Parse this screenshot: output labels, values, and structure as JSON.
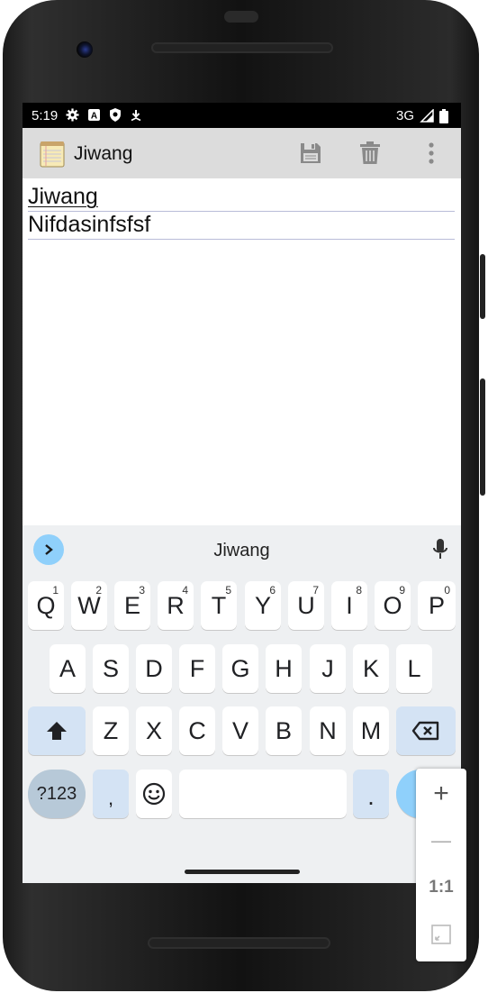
{
  "status_bar": {
    "time": "5:19",
    "network": "3G",
    "icons": [
      "gear-icon",
      "a-badge-icon",
      "shield-icon",
      "download-icon",
      "signal-icon",
      "battery-icon"
    ]
  },
  "app_bar": {
    "title": "Jiwang",
    "actions": [
      "save-icon",
      "delete-icon",
      "overflow-menu-icon"
    ]
  },
  "editor": {
    "lines": [
      "Jiwang",
      "Nifdasinfsfsf"
    ]
  },
  "keyboard": {
    "suggestion": "Jiwang",
    "row1": [
      {
        "label": "Q",
        "hint": "1"
      },
      {
        "label": "W",
        "hint": "2"
      },
      {
        "label": "E",
        "hint": "3"
      },
      {
        "label": "R",
        "hint": "4"
      },
      {
        "label": "T",
        "hint": "5"
      },
      {
        "label": "Y",
        "hint": "6"
      },
      {
        "label": "U",
        "hint": "7"
      },
      {
        "label": "I",
        "hint": "8"
      },
      {
        "label": "O",
        "hint": "9"
      },
      {
        "label": "P",
        "hint": "0"
      }
    ],
    "row2": [
      "A",
      "S",
      "D",
      "F",
      "G",
      "H",
      "J",
      "K",
      "L"
    ],
    "row3": [
      "Z",
      "X",
      "C",
      "V",
      "B",
      "N",
      "M"
    ],
    "symbols_label": "?123",
    "comma": ",",
    "period": "."
  },
  "zoom_control": {
    "zoom_in": "+",
    "zoom_out": "—",
    "reset": "1:1"
  },
  "colors": {
    "app_bar": "#dcdcdc",
    "keyboard_bg": "#eef0f2",
    "accent": "#8fd0fb",
    "modifier_key": "#d4e3f4"
  }
}
